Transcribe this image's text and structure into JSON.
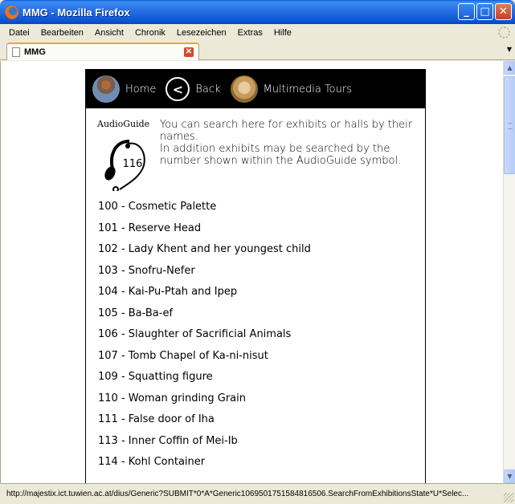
{
  "window": {
    "title": "MMG - Mozilla Firefox"
  },
  "menubar": {
    "items": [
      "Datei",
      "Bearbeiten",
      "Ansicht",
      "Chronik",
      "Lesezeichen",
      "Extras",
      "Hilfe"
    ]
  },
  "tab": {
    "label": "MMG"
  },
  "nav": {
    "home": "Home",
    "back": "Back",
    "tours": "Multimedia Tours"
  },
  "audioguide": {
    "title": "AudioGuide",
    "number": "116",
    "line1": "You can search here for exhibits or halls by their names.",
    "line2": "In addition exhibits may be searched by the number shown within the AudioGuide symbol."
  },
  "exhibits": [
    "100 - Cosmetic Palette",
    "101 - Reserve Head",
    "102 - Lady Khent and her youngest child",
    "103 - Snofru-Nefer",
    "104 - Kai-Pu-Ptah and Ipep",
    "105 - Ba-Ba-ef",
    "106 - Slaughter of Sacrificial Animals",
    "107 - Tomb Chapel of Ka-ni-nisut",
    "109 - Squatting figure",
    "110 - Woman grinding Grain",
    "111 - False door of Iha",
    "113 - Inner Coffin of Mei-Ib",
    "114 - Kohl Container"
  ],
  "status": {
    "url": "http://majestix.ict.tuwien.ac.at/dius/Generic?SUBMIT*0*A*Generic1069501751584816506.SearchFromExhibitionsState*U*Selec..."
  }
}
